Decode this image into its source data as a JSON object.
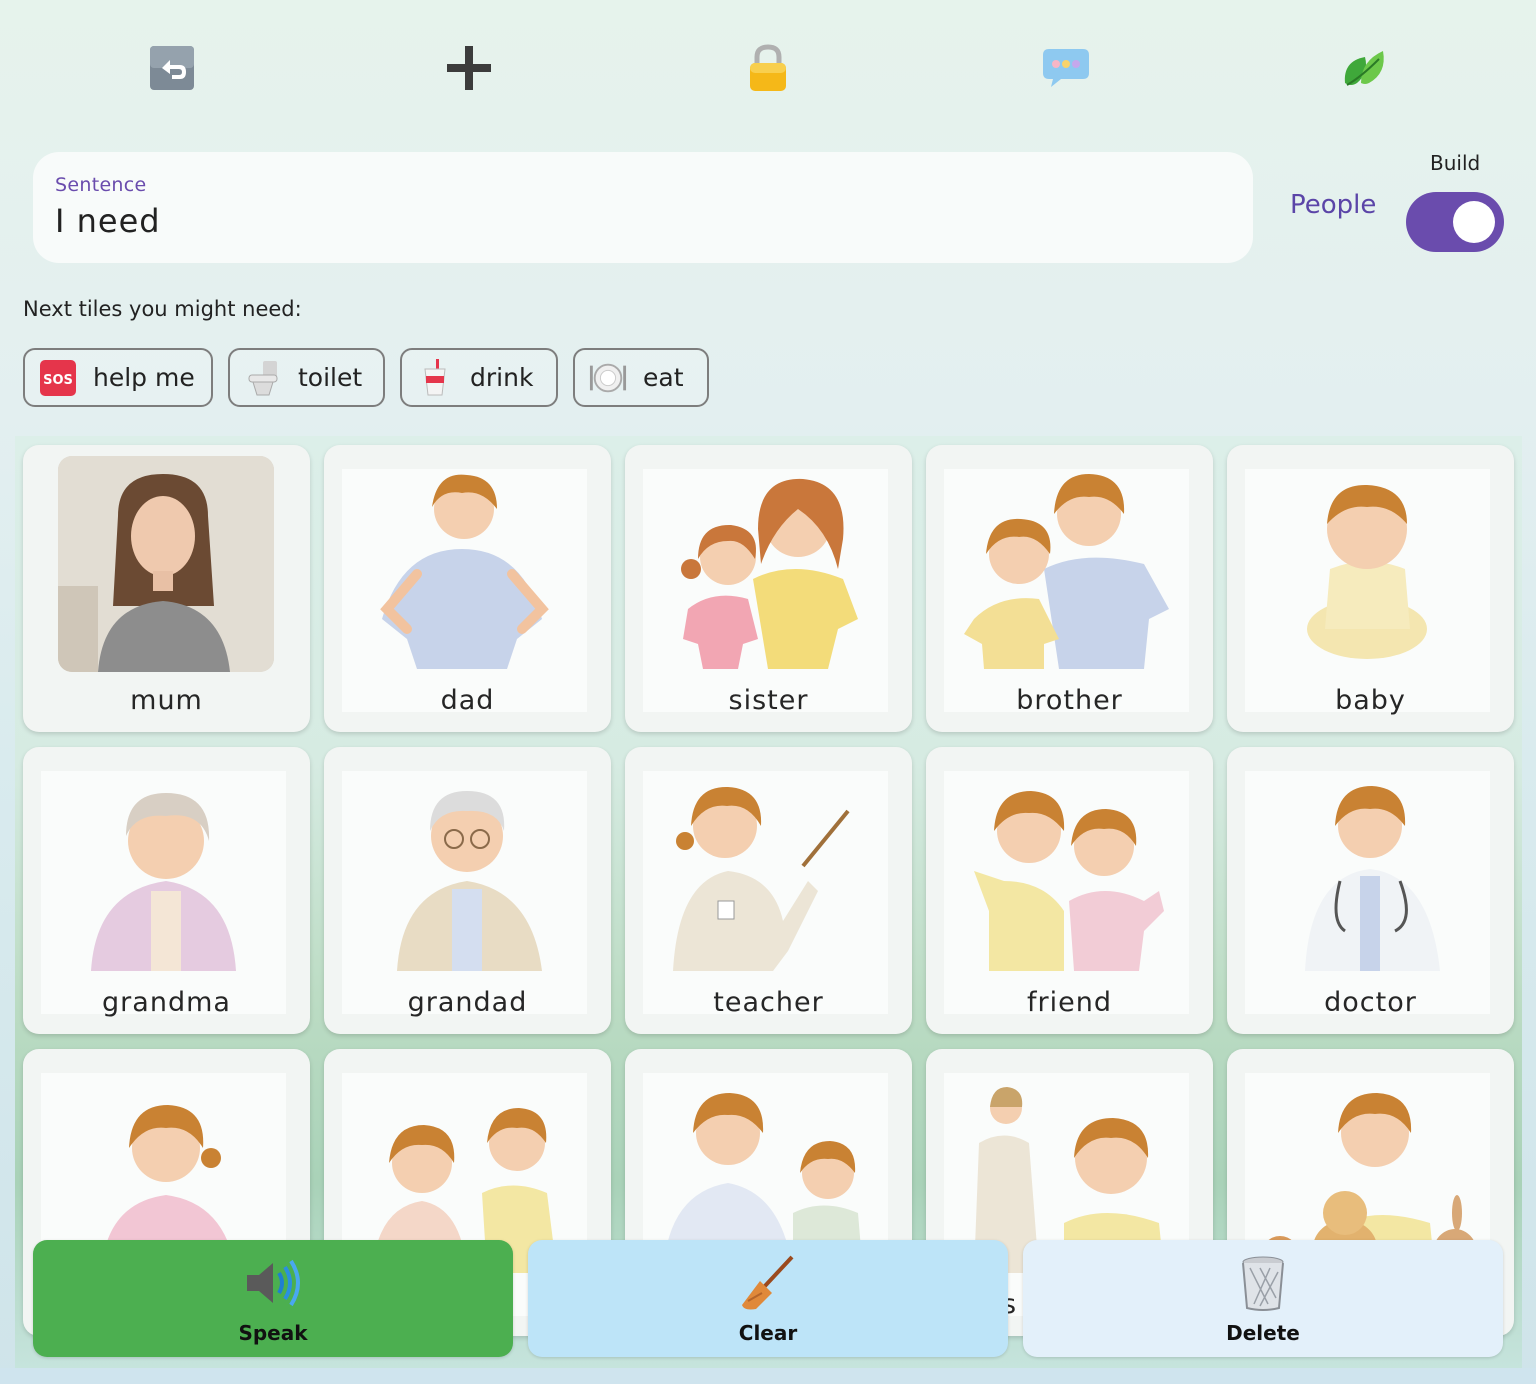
{
  "toolbar": {
    "icons": [
      "undo-icon",
      "add-icon",
      "lock-icon",
      "chat-icon",
      "leaf-icon"
    ]
  },
  "sentence": {
    "label": "Sentence",
    "value": "I need"
  },
  "category": {
    "current": "People",
    "build_label": "Build",
    "build_on": true
  },
  "suggestions": {
    "title": "Next tiles you might need:",
    "items": [
      {
        "label": "help me",
        "icon": "sos-icon"
      },
      {
        "label": "toilet",
        "icon": "toilet-icon"
      },
      {
        "label": "drink",
        "icon": "cup-icon"
      },
      {
        "label": "eat",
        "icon": "plate-icon"
      }
    ]
  },
  "tiles": [
    {
      "label": "mum"
    },
    {
      "label": "dad"
    },
    {
      "label": "sister"
    },
    {
      "label": "brother"
    },
    {
      "label": "baby"
    },
    {
      "label": "grandma"
    },
    {
      "label": "grandad"
    },
    {
      "label": "teacher"
    },
    {
      "label": "friend"
    },
    {
      "label": "doctor"
    },
    {
      "label": ""
    },
    {
      "label": ""
    },
    {
      "label": ""
    },
    {
      "label": "s"
    },
    {
      "label": ""
    }
  ],
  "actions": {
    "speak": "Speak",
    "clear": "Clear",
    "delete": "Delete"
  },
  "colors": {
    "accent": "#6a4cad",
    "speak": "#4caf50",
    "clear": "#bde4f8",
    "delete": "#e3f0fa"
  }
}
